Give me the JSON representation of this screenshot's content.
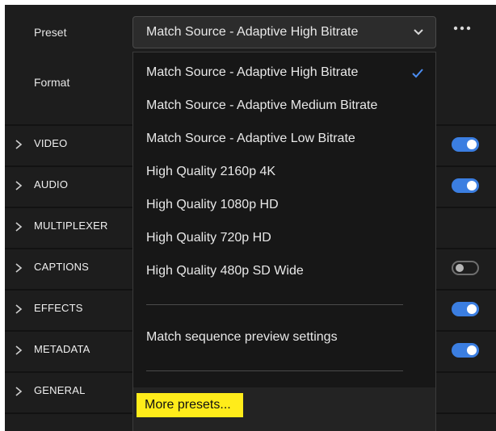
{
  "header": {
    "preset_label": "Preset",
    "format_label": "Format",
    "preset_value": "Match Source - Adaptive High Bitrate"
  },
  "sections": [
    {
      "label": "VIDEO",
      "toggle": "on"
    },
    {
      "label": "AUDIO",
      "toggle": "on"
    },
    {
      "label": "MULTIPLEXER",
      "toggle": "none"
    },
    {
      "label": "CAPTIONS",
      "toggle": "off"
    },
    {
      "label": "EFFECTS",
      "toggle": "on"
    },
    {
      "label": "METADATA",
      "toggle": "on"
    },
    {
      "label": "GENERAL",
      "toggle": "none"
    }
  ],
  "menu": {
    "items": [
      "Match Source - Adaptive High Bitrate",
      "Match Source - Adaptive Medium Bitrate",
      "Match Source - Adaptive Low Bitrate",
      "High Quality 2160p 4K",
      "High Quality 1080p HD",
      "High Quality 720p HD",
      "High Quality 480p SD Wide"
    ],
    "selected_index": 0,
    "match_sequence": "Match sequence preview settings",
    "more_presets": "More presets..."
  },
  "colors": {
    "accent": "#3b7ee1",
    "highlight": "#ffec1a",
    "panel_bg": "#1d1d1d",
    "menu_bg": "#171717"
  }
}
